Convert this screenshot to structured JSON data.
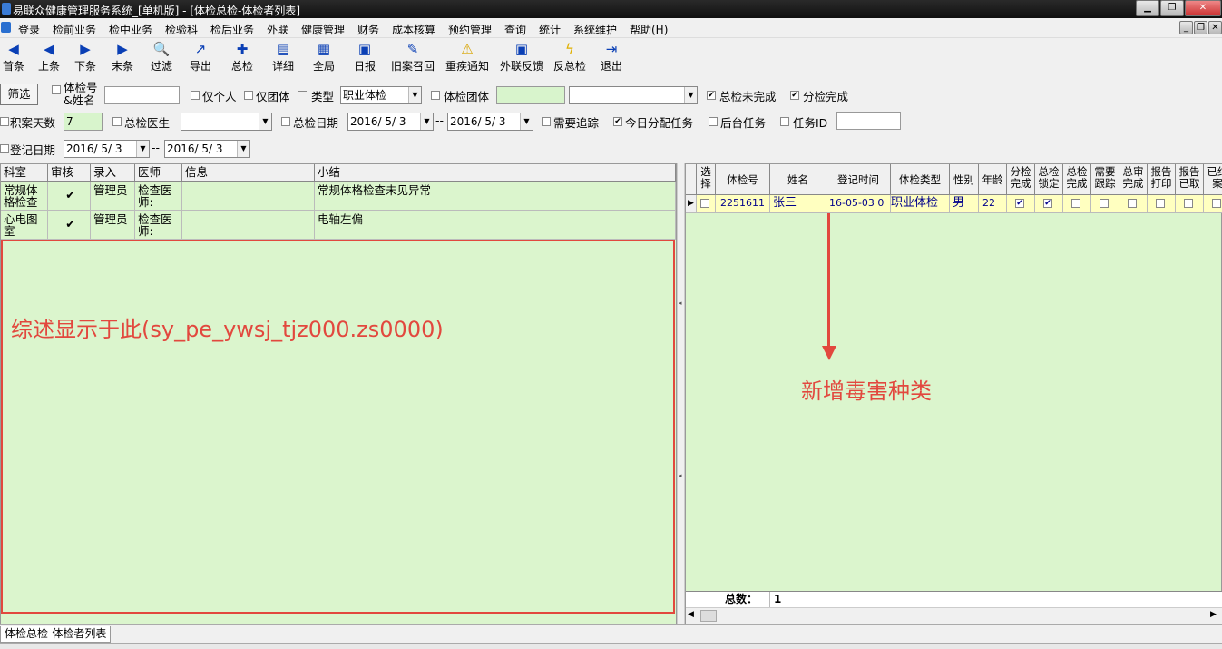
{
  "title": "易联众健康管理服务系统_[单机版] - [体检总检-体检者列表]",
  "menu": [
    "登录",
    "检前业务",
    "检中业务",
    "检验科",
    "检后业务",
    "外联",
    "健康管理",
    "财务",
    "成本核算",
    "预约管理",
    "查询",
    "统计",
    "系统维护",
    "帮助(H)"
  ],
  "toolbar": [
    {
      "label": "首条",
      "icon": "first-icon",
      "glyph": "◀"
    },
    {
      "label": "上条",
      "icon": "prev-icon",
      "glyph": "◀"
    },
    {
      "label": "下条",
      "icon": "next-icon",
      "glyph": "▶"
    },
    {
      "label": "末条",
      "icon": "last-icon",
      "glyph": "▶"
    },
    {
      "label": "过滤",
      "icon": "filter-icon",
      "glyph": "🔍"
    },
    {
      "label": "导出",
      "icon": "export-icon",
      "glyph": "↗"
    },
    {
      "label": "总检",
      "icon": "check-icon",
      "glyph": "✚"
    },
    {
      "label": "详细",
      "icon": "detail-icon",
      "glyph": "▤"
    },
    {
      "label": "全局",
      "icon": "global-icon",
      "glyph": "▦"
    },
    {
      "label": "日报",
      "icon": "daily-icon",
      "glyph": "▣"
    },
    {
      "label": "旧案召回",
      "icon": "recall-icon",
      "glyph": "✎"
    },
    {
      "label": "重疾通知",
      "icon": "warning-icon",
      "glyph": "⚠"
    },
    {
      "label": "外联反馈",
      "icon": "feedback-icon",
      "glyph": "▣"
    },
    {
      "label": "反总检",
      "icon": "undo-icon",
      "glyph": "ϟ"
    },
    {
      "label": "退出",
      "icon": "exit-icon",
      "glyph": "⇥"
    }
  ],
  "filters": {
    "filter_button": "筛选",
    "exam_no_label": "体检号&姓名",
    "personal_only": "仅个人",
    "group_only": "仅团体",
    "type_label": "类型",
    "type_value": "职业体检",
    "group_label": "体检团体",
    "summary_unfinished": "总检未完成",
    "branch_finished": "分检完成",
    "backlog_days_label": "积案天数",
    "backlog_days_value": "7",
    "doctor_label": "总检医生",
    "summary_date_label": "总检日期",
    "date_from": "2016/ 5/ 3",
    "date_to": "2016/ 5/ 3",
    "date_sep": "--",
    "need_track": "需要追踪",
    "today_assigned": "今日分配任务",
    "background_task": "后台任务",
    "task_id_label": "任务ID",
    "register_date_label": "登记日期",
    "reg_from": "2016/ 5/ 3",
    "reg_to": "2016/ 5/ 3"
  },
  "left_grid": {
    "headers": [
      "科室",
      "审核",
      "录入",
      "医师",
      "信息",
      "小结"
    ],
    "rows": [
      {
        "dept": "常规体格检查",
        "audit": true,
        "entry": "管理员",
        "doctor": "检查医师:",
        "info": "",
        "summary": "常规体格检查未见异常"
      },
      {
        "dept": "心电图室",
        "audit": true,
        "entry": "管理员",
        "doctor": "检查医师:",
        "info": "",
        "summary": "电轴左偏"
      }
    ],
    "annotation": "综述显示于此(sy_pe_ywsj_tjz000.zs0000)"
  },
  "right_grid": {
    "headers": [
      "选择",
      "体检号",
      "姓名",
      "登记时间",
      "体检类型",
      "性别",
      "年龄",
      "分检完成",
      "总检锁定",
      "总检完成",
      "需要跟踪",
      "总审完成",
      "报告打印",
      "报告已取",
      "已结案"
    ],
    "row": {
      "exam_no": "2251611",
      "name": "张三",
      "reg_time": "16-05-03 0",
      "type": "职业体检",
      "sex": "男",
      "age": "22",
      "flags": [
        true,
        true,
        false,
        false,
        false,
        false,
        false,
        false
      ]
    },
    "total_label": "总数：",
    "total_value": "1",
    "annotation": "新增毒害种类"
  },
  "tab": "体检总检-体检者列表"
}
